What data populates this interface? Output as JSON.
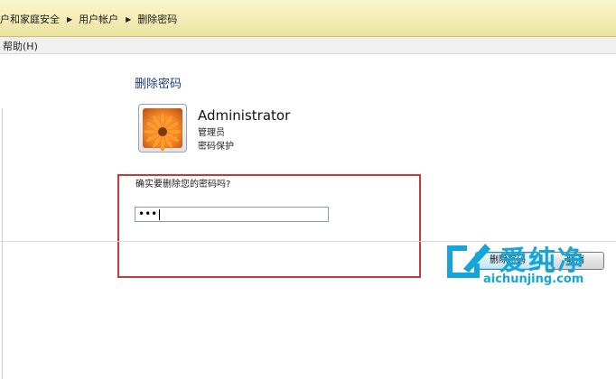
{
  "breadcrumb": {
    "items": [
      "户和家庭安全",
      "用户帐户",
      "删除密码"
    ]
  },
  "menu": {
    "help": "帮助(H)"
  },
  "page": {
    "title": "删除密码"
  },
  "user": {
    "name": "Administrator",
    "role": "管理员",
    "status": "密码保护"
  },
  "form": {
    "confirm_question": "确实要删除您的密码吗?",
    "password_value": "•••"
  },
  "buttons": {
    "delete_label": "删除密码",
    "cancel_label": "取消"
  },
  "watermark": {
    "title": "爱纯净",
    "url": "aichunjing.com"
  },
  "colors": {
    "accent_blue": "#1e3f7c",
    "highlight_red": "#c43a3a",
    "watermark_blue": "#16a5d8",
    "breadcrumb_bg": "#f2ecb3"
  },
  "icons": {
    "separator": "chevron-right-icon",
    "avatar": "flower-avatar-icon",
    "watermark_logo": "watermark-logo-icon"
  }
}
